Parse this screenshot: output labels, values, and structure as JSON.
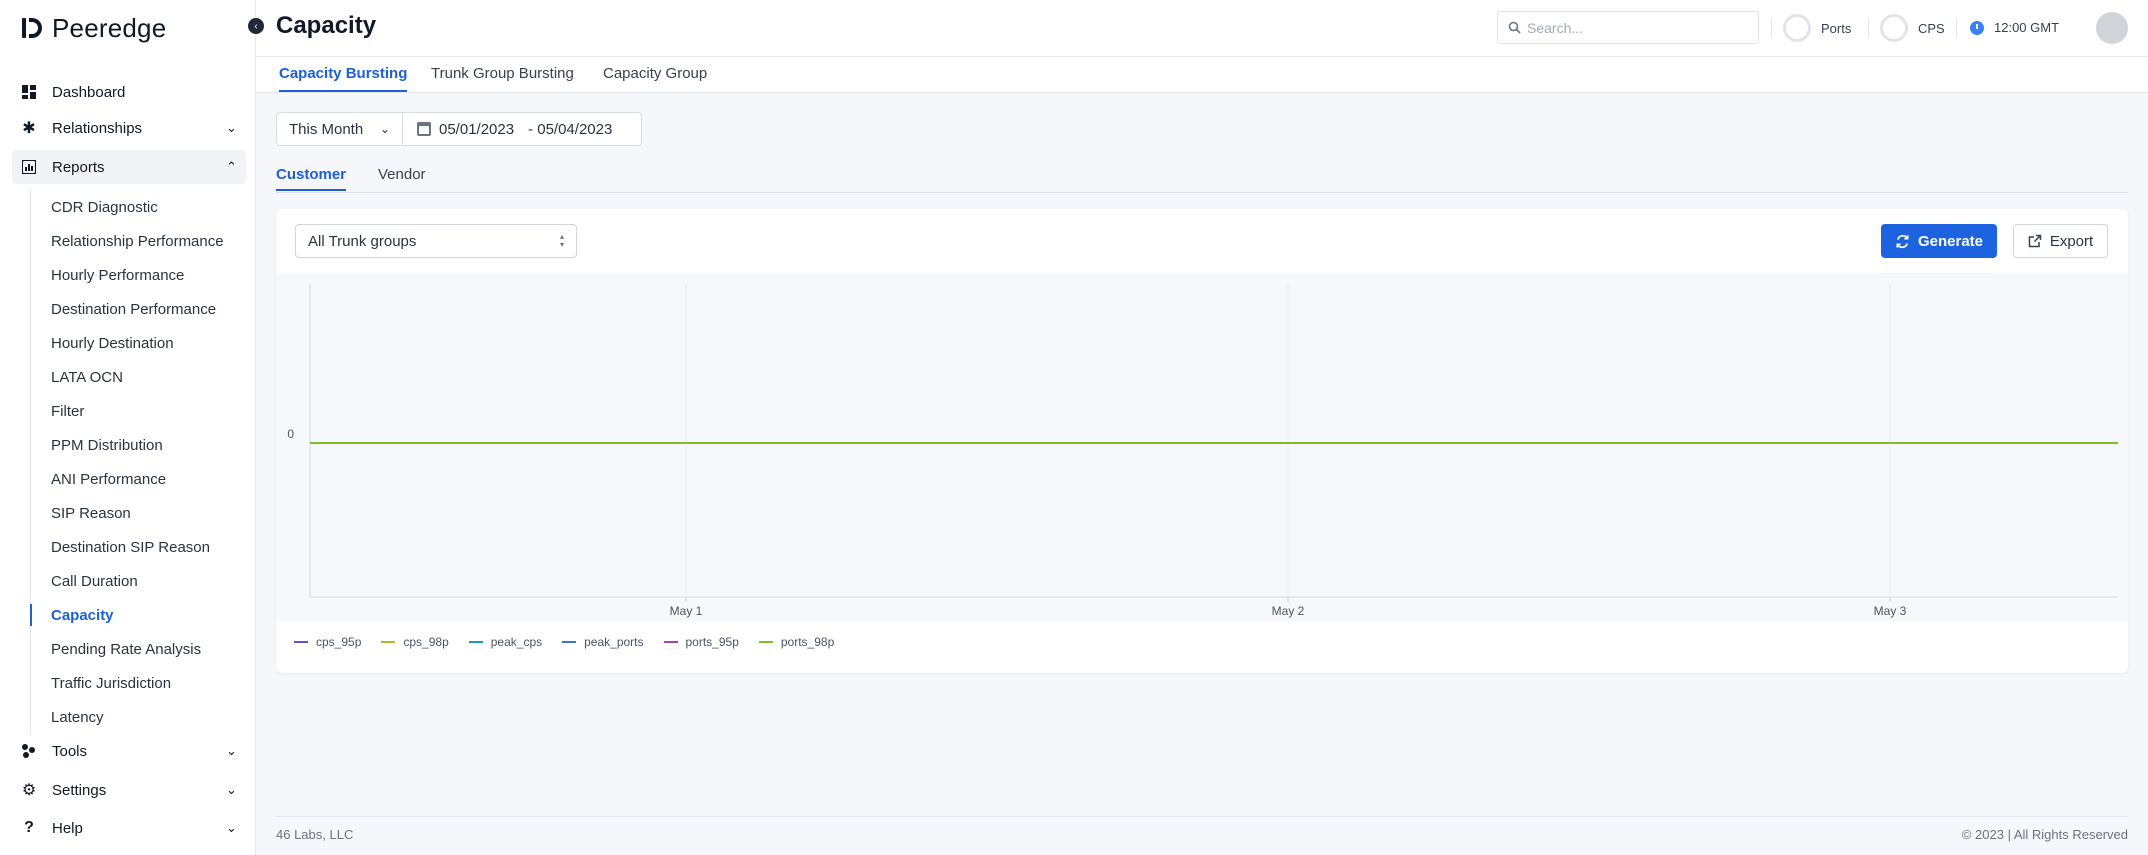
{
  "app": {
    "name": "Peeredge"
  },
  "sidebar": {
    "items": [
      {
        "label": "Dashboard",
        "icon": "dashboard-icon"
      },
      {
        "label": "Relationships",
        "icon": "relationships-icon"
      },
      {
        "label": "Reports",
        "icon": "reports-icon"
      },
      {
        "label": "Tools",
        "icon": "tools-icon"
      },
      {
        "label": "Settings",
        "icon": "gear-icon"
      },
      {
        "label": "Help",
        "icon": "help-icon"
      }
    ],
    "report_items": [
      "CDR Diagnostic",
      "Relationship Performance",
      "Hourly Performance",
      "Destination Performance",
      "Hourly Destination",
      "LATA OCN",
      "Filter",
      "PPM Distribution",
      "ANI Performance",
      "SIP Reason",
      "Destination SIP Reason",
      "Call Duration",
      "Capacity",
      "Pending Rate Analysis",
      "Traffic Jurisdiction",
      "Latency"
    ],
    "active_report": "Capacity"
  },
  "header": {
    "title": "Capacity",
    "search_placeholder": "Search...",
    "ports_label": "Ports",
    "cps_label": "CPS",
    "time": "12:00 GMT"
  },
  "tabs": [
    "Capacity Bursting",
    "Trunk Group Bursting",
    "Capacity Group"
  ],
  "filter": {
    "period": "This Month",
    "date_from": "05/01/2023",
    "date_to": "- 05/04/2023"
  },
  "subtabs": [
    "Customer",
    "Vendor"
  ],
  "card": {
    "trunk_select": "All Trunk groups",
    "generate_label": "Generate",
    "export_label": "Export"
  },
  "chart_data": {
    "type": "line",
    "x": [
      "May 1",
      "May 2",
      "May 3"
    ],
    "y_ticks": [
      "0"
    ],
    "series": [
      {
        "name": "cps_95p",
        "color": "#6d4bd8",
        "values": [
          0,
          0,
          0
        ]
      },
      {
        "name": "cps_98p",
        "color": "#a8c12a",
        "values": [
          0,
          0,
          0
        ]
      },
      {
        "name": "peak_cps",
        "color": "#1a9db0",
        "values": [
          0,
          0,
          0
        ]
      },
      {
        "name": "peak_ports",
        "color": "#3b6fe0",
        "values": [
          0,
          0,
          0
        ]
      },
      {
        "name": "ports_95p",
        "color": "#a43fb5",
        "values": [
          0,
          0,
          0
        ]
      },
      {
        "name": "ports_98p",
        "color": "#7cbf2a",
        "values": [
          0,
          0,
          0
        ]
      }
    ]
  },
  "footer": {
    "left": "46 Labs, LLC",
    "right": "© 2023 | All Rights Reserved"
  }
}
